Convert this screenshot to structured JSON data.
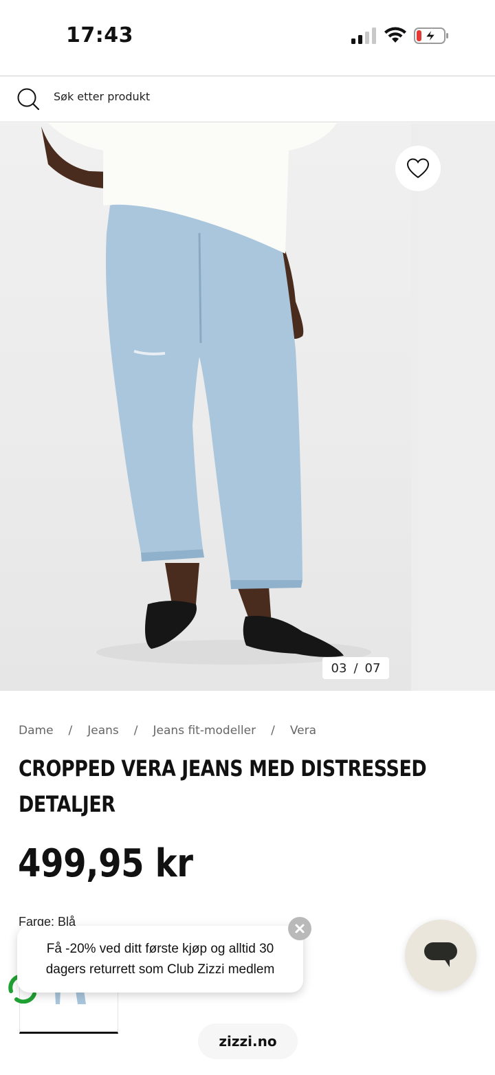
{
  "status_bar": {
    "time": "17:43"
  },
  "search": {
    "placeholder": "Søk etter produkt"
  },
  "gallery": {
    "current": "03",
    "separator": "/",
    "total": "07"
  },
  "breadcrumb": [
    "Dame",
    "Jeans",
    "Jeans fit-modeller",
    "Vera"
  ],
  "breadcrumb_separator": "/",
  "product": {
    "title": "CROPPED VERA JEANS MED DISTRESSED DETALJER",
    "price": "499,95 kr",
    "color_label": "Farge: Blå"
  },
  "promo": {
    "text": "Få -20% ved ditt første kjøp og alltid 30 dagers returrett som Club Zizzi medlem"
  },
  "browser": {
    "url": "zizzi.no"
  },
  "colors": {
    "denim": "#a9c6dc",
    "chat_bg": "#eae6dc",
    "battery_low": "#e53935"
  }
}
